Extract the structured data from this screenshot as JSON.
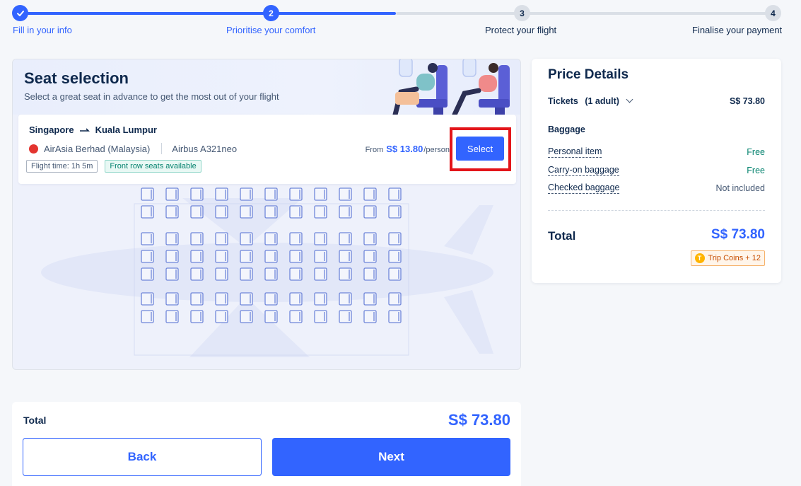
{
  "stepper": {
    "steps": [
      {
        "label": "Fill in your info",
        "number": "",
        "state": "done"
      },
      {
        "label": "Prioritise your comfort",
        "number": "2",
        "state": "active"
      },
      {
        "label": "Protect your flight",
        "number": "3",
        "state": "todo"
      },
      {
        "label": "Finalise your payment",
        "number": "4",
        "state": "todo"
      }
    ]
  },
  "seat_selection": {
    "title": "Seat selection",
    "subtitle": "Select a great seat in advance to get the most out of your flight",
    "flight": {
      "origin": "Singapore",
      "destination": "Kuala Lumpur",
      "route_icon": "plane-arrow-icon",
      "airline": "AirAsia Berhad (Malaysia)",
      "aircraft": "Airbus A321neo",
      "tags": [
        "Flight time: 1h 5m",
        "Front row seats available"
      ],
      "from_label": "From",
      "price": "S$ 13.80",
      "per": "/person",
      "select_label": "Select"
    }
  },
  "price_details": {
    "title": "Price Details",
    "tickets_label": "Tickets",
    "tickets_qty": "(1 adult)",
    "tickets_price": "S$ 73.80",
    "baggage_heading": "Baggage",
    "baggage": [
      {
        "name": "Personal item",
        "value": "Free"
      },
      {
        "name": "Carry-on baggage",
        "value": "Free"
      },
      {
        "name": "Checked baggage",
        "value": "Not included"
      }
    ],
    "total_label": "Total",
    "total_value": "S$ 73.80",
    "coins": "Trip Coins + 12"
  },
  "footer": {
    "total_label": "Total",
    "total_value": "S$ 73.80",
    "back_label": "Back",
    "next_label": "Next"
  },
  "colors": {
    "accent": "#3264ff",
    "highlight": "#e3151a",
    "free": "#06836f"
  }
}
